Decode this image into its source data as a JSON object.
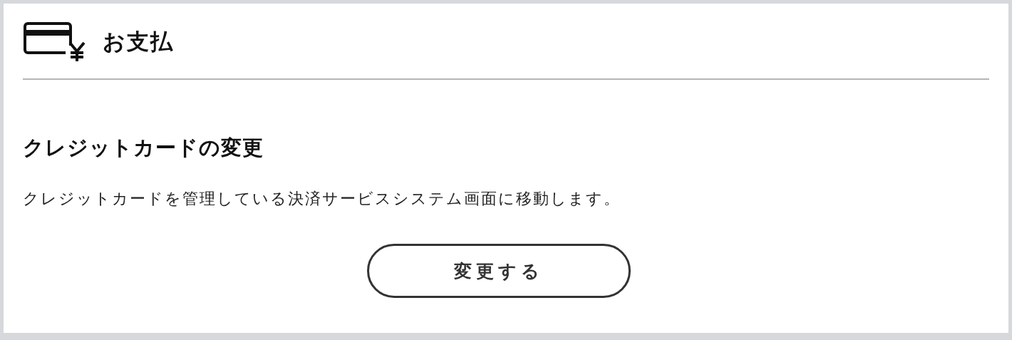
{
  "header": {
    "title": "お支払"
  },
  "section": {
    "title": "クレジットカードの変更",
    "description": "クレジットカードを管理している決済サービスシステム画面に移動します。"
  },
  "button": {
    "label": "変更する"
  }
}
